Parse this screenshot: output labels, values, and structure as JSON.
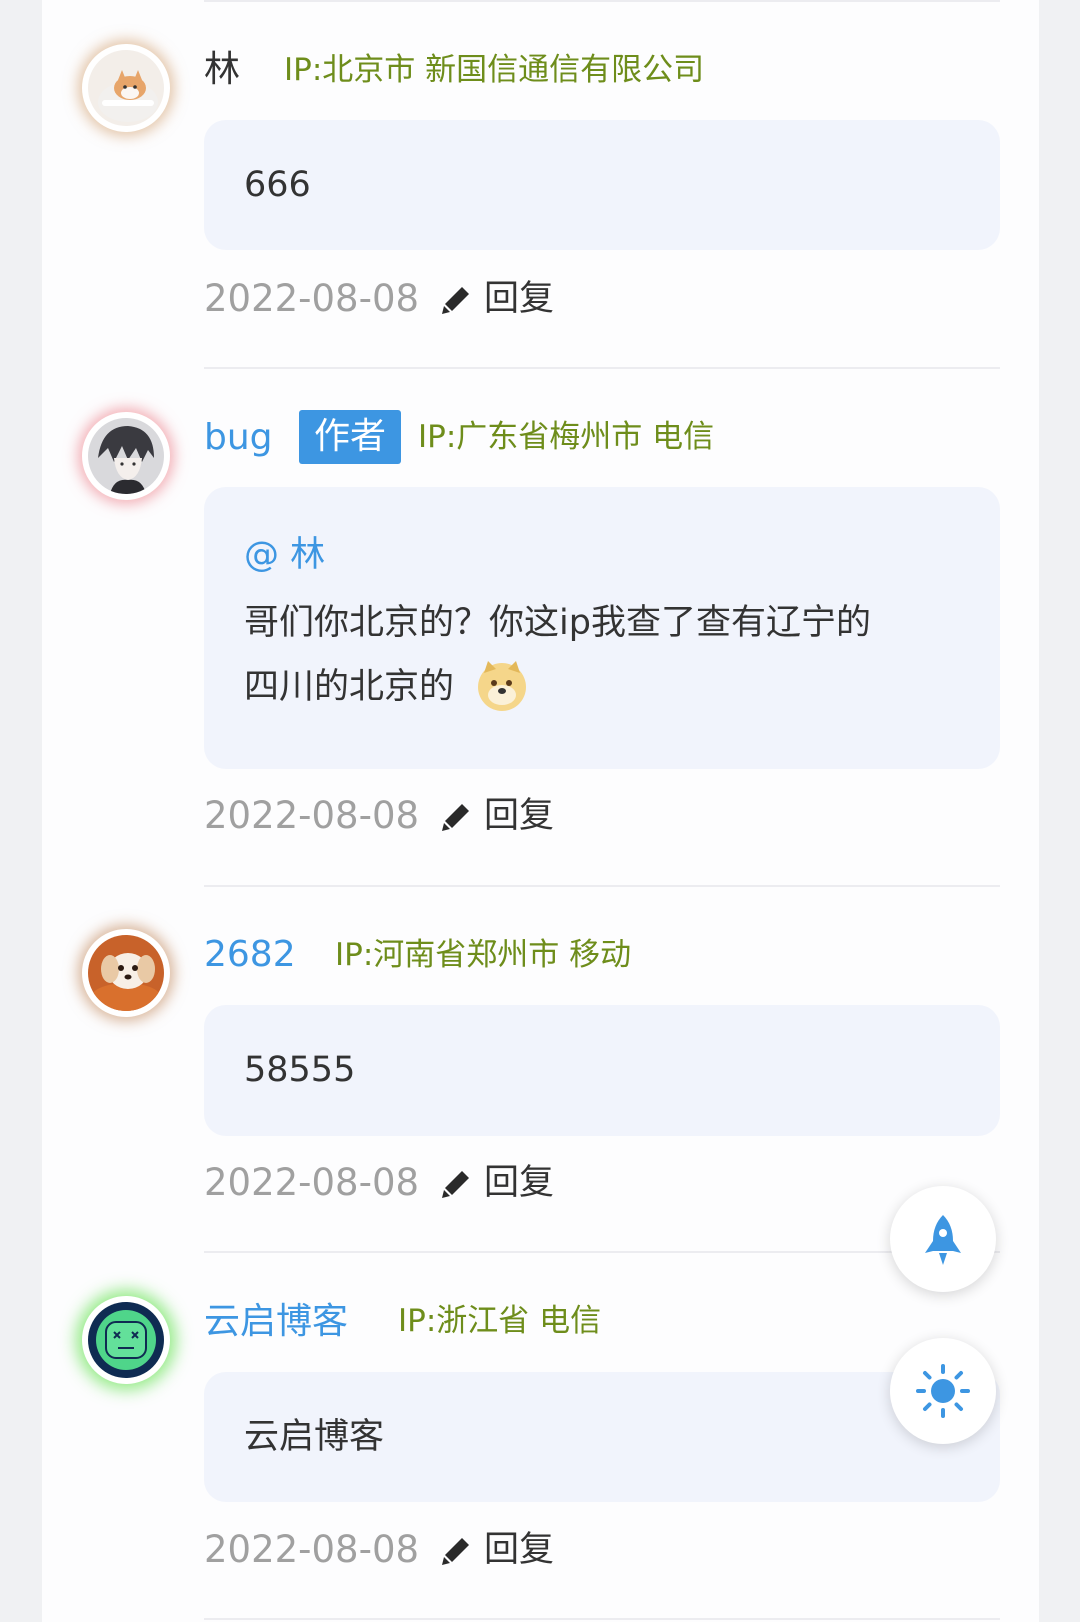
{
  "comments": [
    {
      "name": "林",
      "ip": "IP:北京市 新国信通信有限公司",
      "text": "666",
      "date": "2022-08-08",
      "reply_label": "回复",
      "avatar": "cat-avatar"
    },
    {
      "name": "bug",
      "badge": "作者",
      "ip": "IP:广东省梅州市 电信",
      "mention": "@ 林",
      "text_line1": "哥们你北京的？你这ip我查了查有辽宁的",
      "text_line2": "四川的北京的",
      "emoji": "doge-emoji",
      "date": "2022-08-08",
      "reply_label": "回复",
      "avatar": "anime-boy-avatar"
    },
    {
      "name": "2682",
      "ip": "IP:河南省郑州市 移动",
      "text": "58555",
      "date": "2022-08-08",
      "reply_label": "回复",
      "avatar": "puppy-avatar"
    },
    {
      "name": "云启博客",
      "ip": "IP:浙江省 电信",
      "text": "云启博客",
      "date": "2022-08-08",
      "reply_label": "回复",
      "avatar": "robot-face-avatar"
    }
  ],
  "floating_buttons": [
    {
      "icon": "rocket-icon",
      "action": "back-to-top"
    },
    {
      "icon": "sun-icon",
      "action": "theme-toggle"
    }
  ],
  "colors": {
    "accent_blue": "#3d96e2",
    "ip_green": "#6e8d1b",
    "bubble_bg": "#f1f4fc",
    "date_gray": "#a0a0a0"
  }
}
